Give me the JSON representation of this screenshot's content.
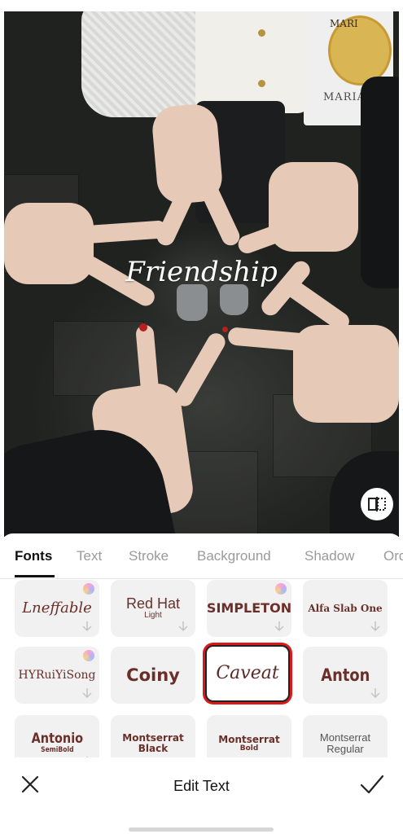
{
  "photo": {
    "overlay_text": "Friendship",
    "bag_brand_top": "MARI",
    "bag_brand_bottom": "MARIA"
  },
  "tabs": [
    {
      "label": "Fonts",
      "active": true
    },
    {
      "label": "Text",
      "active": false
    },
    {
      "label": "Stroke",
      "active": false
    },
    {
      "label": "Background",
      "active": false
    },
    {
      "label": "Shadow",
      "active": false
    },
    {
      "label": "Ord",
      "active": false
    }
  ],
  "fonts": [
    {
      "label": "Lneffable",
      "premium": true,
      "downloadable": true
    },
    {
      "label": "Red Hat",
      "sub": "Light",
      "premium": false,
      "downloadable": true
    },
    {
      "label": "SIMPLETON",
      "premium": true,
      "downloadable": true
    },
    {
      "label": "Alfa Slab One",
      "premium": false,
      "downloadable": true
    },
    {
      "label": "HYRuiYiSong",
      "premium": true,
      "downloadable": true
    },
    {
      "label": "Coiny",
      "premium": false,
      "downloadable": false
    },
    {
      "label": "Caveat",
      "premium": false,
      "downloadable": false,
      "selected": true
    },
    {
      "label": "Anton",
      "premium": false,
      "downloadable": true
    },
    {
      "label": "Antonio",
      "sub": "SemiBold",
      "premium": false,
      "downloadable": true
    },
    {
      "label": "Montserrat Black",
      "premium": false,
      "downloadable": false
    },
    {
      "label": "Montserrat",
      "sub": "Bold",
      "premium": false,
      "downloadable": false
    },
    {
      "label": "Montserrat Regular",
      "premium": false,
      "downloadable": false
    }
  ],
  "bottom_bar": {
    "title": "Edit Text"
  },
  "colors": {
    "accent_selected": "#d9191c",
    "font_preview": "#6b2f2a",
    "card_bg": "#f1f1f1"
  },
  "icons": {
    "compare": "compare-icon",
    "premium": "gem-icon",
    "download": "download-arrow-icon",
    "close": "close-icon",
    "confirm": "checkmark-icon"
  }
}
